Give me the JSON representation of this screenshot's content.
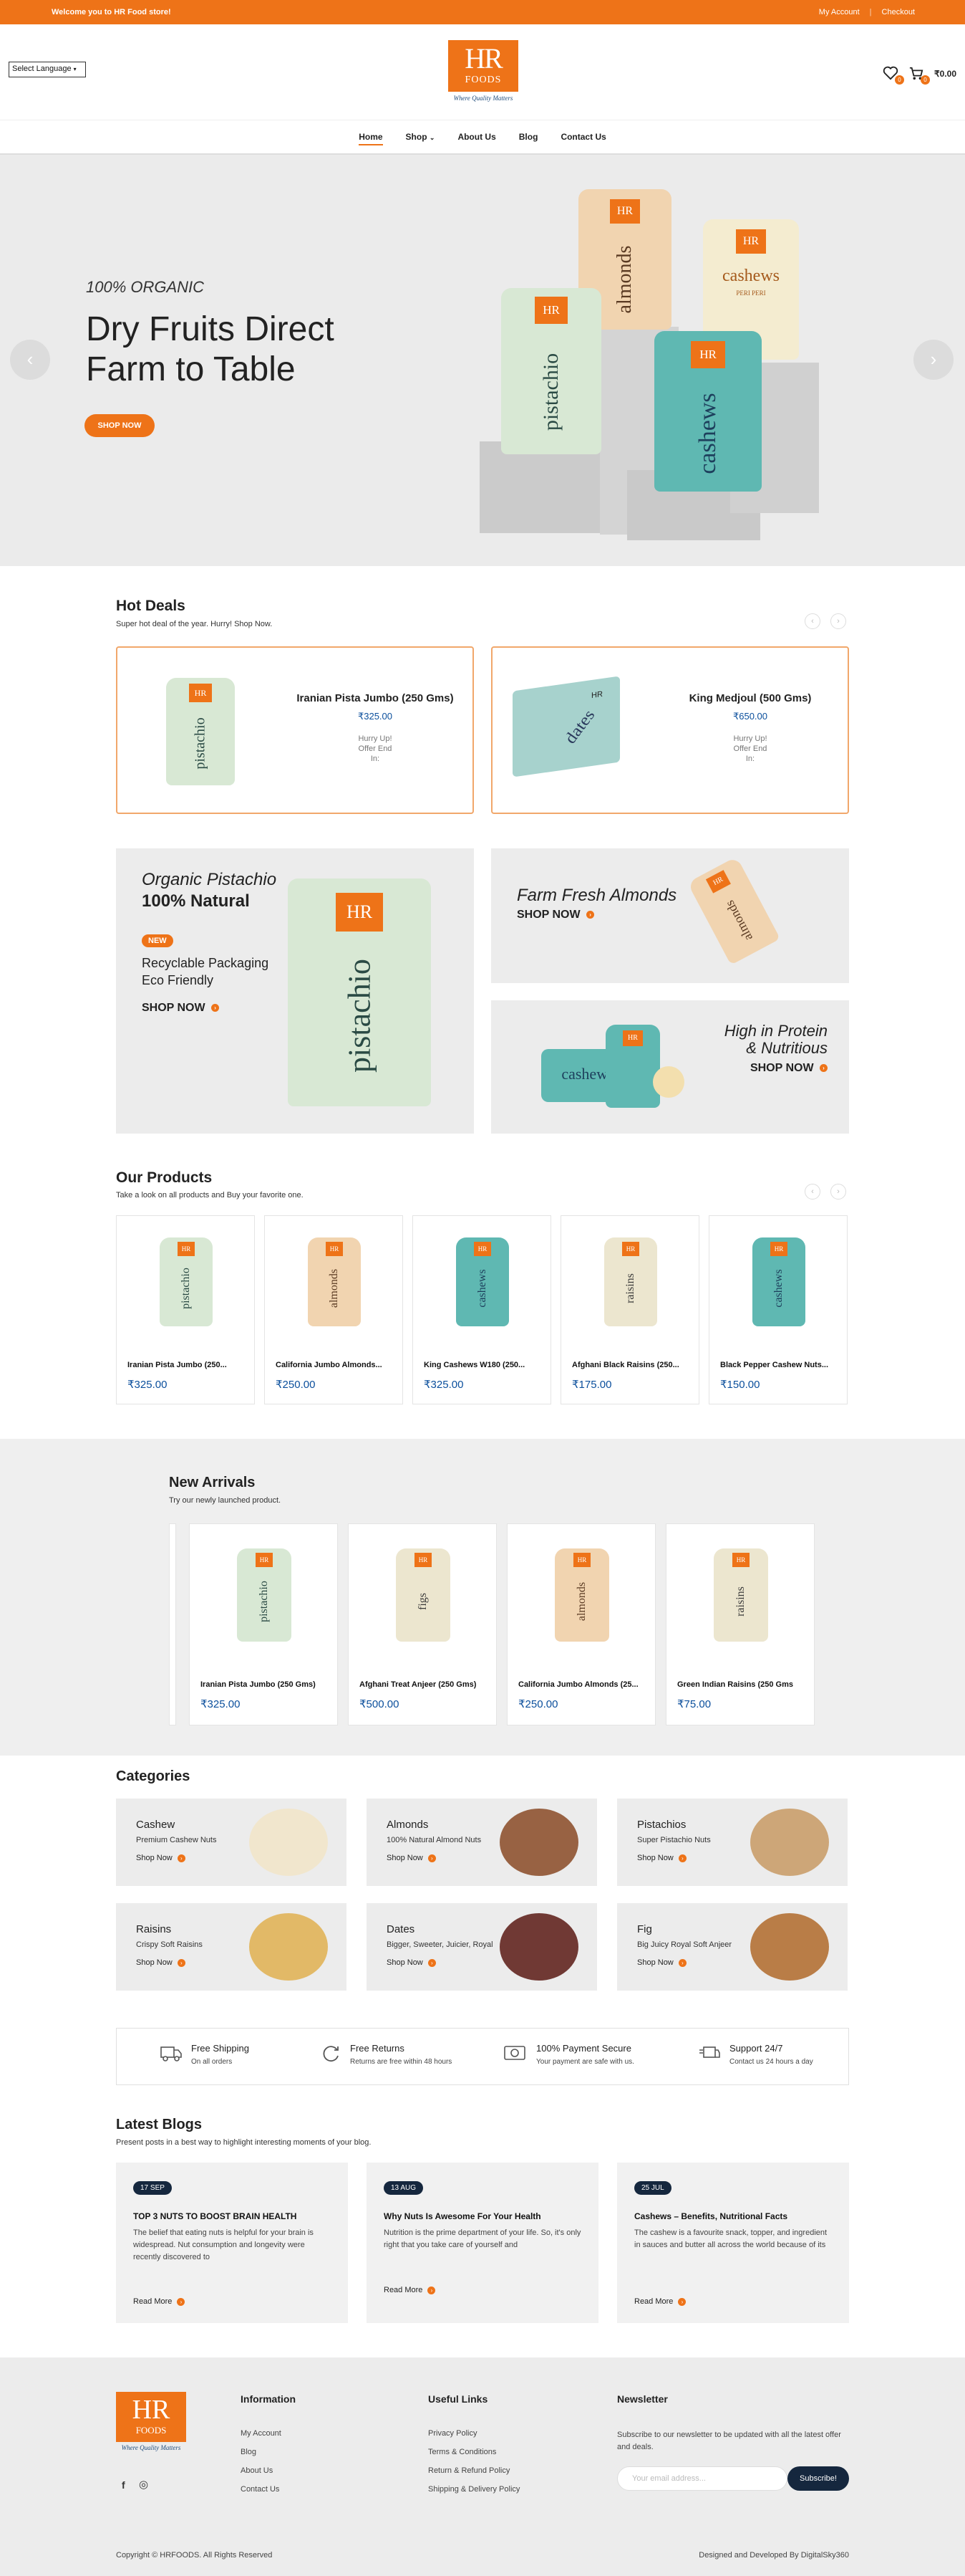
{
  "topbar": {
    "welcome": "Welcome you to HR Food store!",
    "my_account": "My Account",
    "checkout": "Checkout",
    "separator": "|"
  },
  "header": {
    "language": "Select Language",
    "logo_hr": "HR",
    "logo_foods": "FOODS",
    "logo_tag": "Where Quality Matters",
    "wishlist_count": "0",
    "cart_count": "0",
    "cart_total": "₹0.00"
  },
  "nav": {
    "items": [
      "Home",
      "Shop",
      "About Us",
      "Blog",
      "Contact Us"
    ],
    "shop_caret": "⌄"
  },
  "hero": {
    "sub": "100% ORGANIC",
    "title": "Dry Fruits Direct Farm to Table",
    "button": "SHOP NOW",
    "prev": "‹",
    "next": "›",
    "cans": {
      "almonds": "almonds",
      "pistachio": "pistachio",
      "cashews": "cashews",
      "cashews_peri": "cashews",
      "peri": "PERI PERI"
    }
  },
  "hot_deals": {
    "title": "Hot Deals",
    "subtitle": "Super hot deal of the year. Hurry! Shop Now.",
    "prev": "‹",
    "next": "›",
    "deals": [
      {
        "name": "Iranian Pista Jumbo (250 Gms)",
        "price": "₹325.00",
        "hurry": "Hurry Up!",
        "offer": "Offer End",
        "in": "In:",
        "img": "pistachio"
      },
      {
        "name": "King Medjoul (500 Gms)",
        "price": "₹650.00",
        "hurry": "Hurry Up!",
        "offer": "Offer End",
        "in": "In:",
        "img": "dates"
      }
    ]
  },
  "promos": {
    "organic_title": "Organic Pistachio",
    "organic_natural": "100% Natural",
    "new_badge": "NEW",
    "recyclable": "Recyclable Packaging",
    "eco": "Eco Friendly",
    "shop_now": "SHOP NOW",
    "almond_title": "Farm Fresh Almonds",
    "almond_shop": "SHOP NOW",
    "protein_title1": "High in Protein",
    "protein_title2": "& Nutritious",
    "protein_shop": "SHOP NOW",
    "arrow": "›",
    "can_pistachio": "pistachio",
    "can_almonds": "almonds",
    "can_cashews": "cashews"
  },
  "our_products": {
    "title": "Our Products",
    "subtitle": "Take a look on all products and Buy your favorite one.",
    "prev": "‹",
    "next": "›",
    "items": [
      {
        "name": "Iranian Pista Jumbo (250...",
        "price": "₹325.00",
        "can": "pistachio"
      },
      {
        "name": "California Jumbo Almonds...",
        "price": "₹250.00",
        "can": "almonds"
      },
      {
        "name": "King Cashews W180 (250...",
        "price": "₹325.00",
        "can": "cashews"
      },
      {
        "name": "Afghani Black Raisins (250...",
        "price": "₹175.00",
        "can": "raisins"
      },
      {
        "name": "Black Pepper Cashew Nuts...",
        "price": "₹150.00",
        "can": "cashews"
      }
    ]
  },
  "new_arrivals": {
    "title": "New Arrivals",
    "subtitle": "Try our newly launched product.",
    "items": [
      {
        "name": "Iranian Pista Jumbo (250 Gms)",
        "price": "₹325.00",
        "can": "pistachio"
      },
      {
        "name": "Afghani Treat Anjeer (250 Gms)",
        "price": "₹500.00",
        "can": "figs"
      },
      {
        "name": "California Jumbo Almonds (25...",
        "price": "₹250.00",
        "can": "almonds"
      },
      {
        "name": "Green Indian Raisins (250 Gms",
        "price": "₹75.00",
        "can": "raisins"
      }
    ]
  },
  "categories": {
    "title": "Categories",
    "shop_now": "Shop Now",
    "items": [
      {
        "name": "Cashew",
        "desc": "Premium Cashew Nuts"
      },
      {
        "name": "Almonds",
        "desc": "100% Natural Almond Nuts"
      },
      {
        "name": "Pistachios",
        "desc": "Super Pistachio Nuts"
      },
      {
        "name": "Raisins",
        "desc": "Crispy Soft Raisins"
      },
      {
        "name": "Dates",
        "desc": "Bigger, Sweeter, Juicier, Royal"
      },
      {
        "name": "Fig",
        "desc": "Big Juicy Royal Soft Anjeer"
      }
    ]
  },
  "features": [
    {
      "title": "Free Shipping",
      "desc": "On all orders"
    },
    {
      "title": "Free Returns",
      "desc": "Returns are free within 48 hours"
    },
    {
      "title": "100% Payment Secure",
      "desc": "Your payment are safe with us."
    },
    {
      "title": "Support 24/7",
      "desc": "Contact us 24 hours a day"
    }
  ],
  "blogs": {
    "title": "Latest Blogs",
    "subtitle": "Present posts in a best way to highlight interesting moments of your blog.",
    "read_more": "Read More",
    "items": [
      {
        "date": "17 SEP",
        "title": "TOP 3 NUTS TO BOOST BRAIN HEALTH",
        "excerpt": "The belief that eating nuts is helpful for your brain is widespread. Nut consumption and longevity were recently discovered to"
      },
      {
        "date": "13 AUG",
        "title": "Why Nuts Is Awesome For Your Health",
        "excerpt": "Nutrition is the prime department of your life. So, it's only right that you take care of yourself and"
      },
      {
        "date": "25 JUL",
        "title": "Cashews – Benefits, Nutritional Facts",
        "excerpt": "The cashew is a favourite snack, topper, and ingredient in sauces and butter all across the world because of its"
      }
    ]
  },
  "footer": {
    "info_title": "Information",
    "info": [
      "My Account",
      "Blog",
      "About Us",
      "Contact Us"
    ],
    "useful_title": "Useful Links",
    "useful": [
      "Privacy Policy",
      "Terms & Conditions",
      "Return & Refund Policy",
      "Shipping & Delivery Policy"
    ],
    "newsletter_title": "Newsletter",
    "newsletter_text": "Subscribe to our newsletter to be updated with all the latest offer and deals.",
    "email_placeholder": "Your email address...",
    "subscribe": "Subscribe!",
    "copyright": "Copyright © HRFOODS. All Rights Reserved",
    "credit": "Designed and Developed By DigitalSky360",
    "facebook": "f",
    "instagram": "◎"
  },
  "colors": {
    "accent": "#ee7318",
    "navy": "#15273e",
    "price": "#0b4f9c",
    "pistachio_can": "#d8e8d4",
    "almond_can": "#f1d4b0",
    "cashew_can": "#5fb8b2",
    "raisin_can": "#ece6cf"
  }
}
